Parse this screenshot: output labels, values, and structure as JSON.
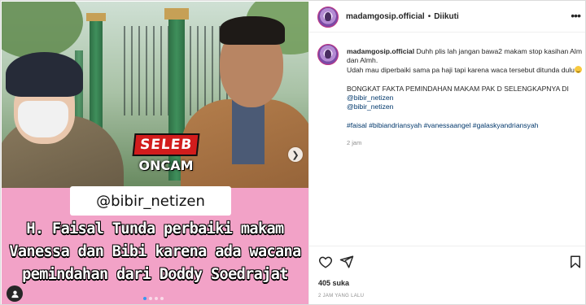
{
  "post": {
    "username": "madamgosip.official",
    "separator": "•",
    "follow_status": "Diikuti",
    "more_icon": "more-options-icon"
  },
  "media": {
    "watermark_top": "SELEB",
    "watermark_bottom": "ONCAM",
    "handle": "@bibir_netizen",
    "caption_lines": [
      "H. Faisal Tunda perbaiki makam",
      "Vanessa dan Bibi karena ada wacana",
      "pemindahan dari Doddy Soedrajat"
    ],
    "carousel": {
      "count": 4,
      "active_index": 0
    },
    "next_icon": "chevron-right-icon",
    "tag_icon": "user-tag-icon"
  },
  "caption": {
    "username": "madamgosip.official",
    "line1": "Duhh plis lah jangan bawa2 makam stop kasihan Alm dan Almh.",
    "line2": "Udah mau diperbaiki sama pa haji tapi karena waca tersebut ditunda dulu",
    "line3": "BONGKAT FAKTA PEMINDAHAN MAKAM PAK D SELENGKAPNYA DI",
    "mention1": "@bibir_netizen",
    "mention2": "@bibir_netizen",
    "hashtags": "#faisal #bibiandriansyah #vanessaangel #galaskyandriansyah",
    "time": "2 jam"
  },
  "actions": {
    "likes": "405 suka",
    "time_ago": "2 JAM YANG LALU",
    "icons": [
      "heart-icon",
      "share-icon",
      "bookmark-icon"
    ]
  },
  "colors": {
    "pink_banner": "#f2a2c7",
    "link": "#00376b",
    "muted": "#8e8e8e",
    "watermark_red": "#d21c1c"
  }
}
